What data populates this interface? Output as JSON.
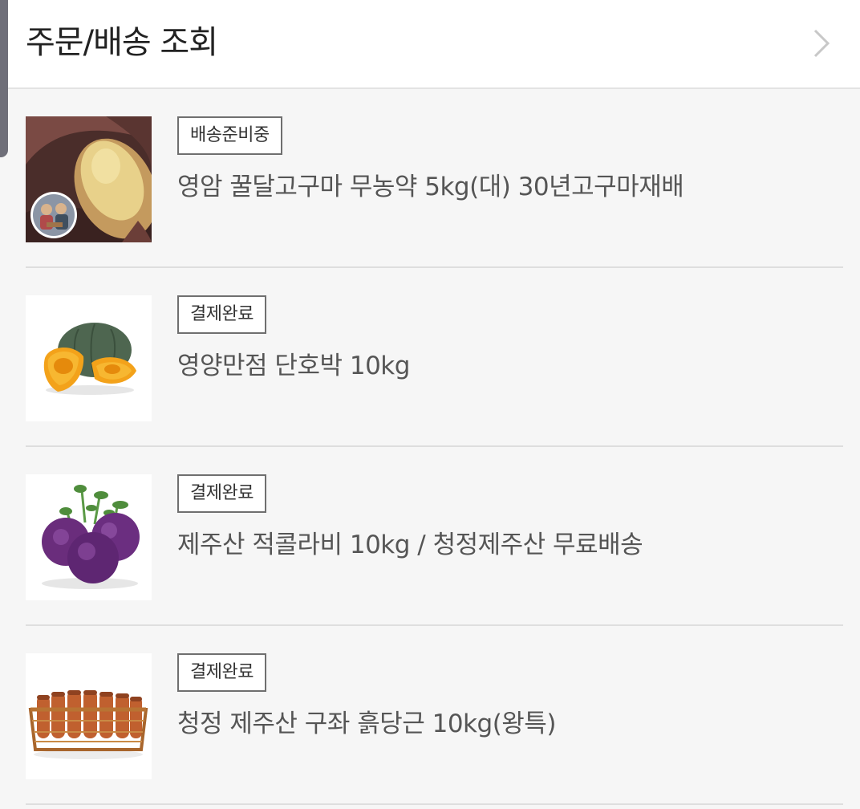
{
  "header": {
    "title": "주문/배송 조회",
    "chevron_icon": "chevron-right-icon"
  },
  "orders": [
    {
      "status": "배송준비중",
      "name": "영암 꿀달고구마 무농약 5kg(대) 30년고구마재배",
      "image": "sweet-potato-photo"
    },
    {
      "status": "결제완료",
      "name": "영양만점 단호박 10kg",
      "image": "pumpkin-photo"
    },
    {
      "status": "결제완료",
      "name": "제주산 적콜라비 10kg / 청정제주산 무료배송",
      "image": "kohlrabi-photo"
    },
    {
      "status": "결제완료",
      "name": "청정 제주산 구좌 흙당근 10kg(왕특)",
      "image": "carrot-photo"
    }
  ],
  "colors": {
    "background": "#f6f6f6",
    "header_background": "#ffffff",
    "badge_border": "#6f6f6f",
    "divider": "#dedede"
  }
}
